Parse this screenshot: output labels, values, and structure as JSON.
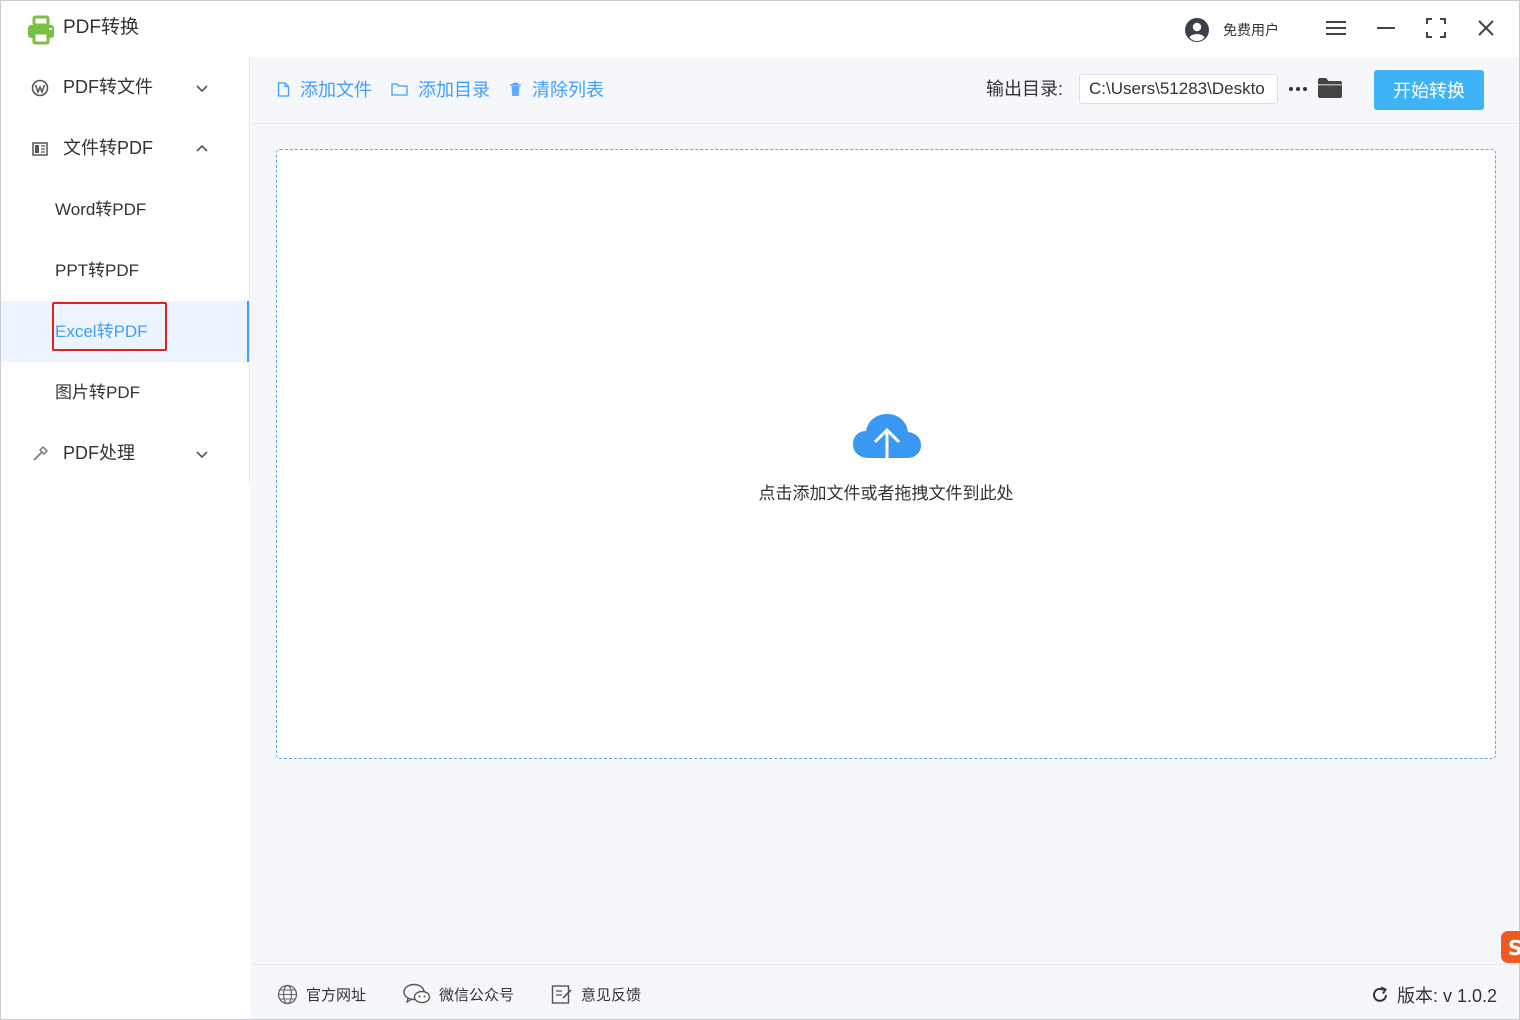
{
  "app": {
    "title": "PDF转换",
    "brand_color": "#7ac143"
  },
  "user": {
    "name": "免费用户"
  },
  "window_controls": [
    "menu-icon",
    "minimize-icon",
    "maximize-icon",
    "close-icon"
  ],
  "sidebar": {
    "groups": [
      {
        "label": "PDF转文件",
        "icon": "wordpress-icon",
        "expanded": false
      },
      {
        "label": "文件转PDF",
        "icon": "document-icon",
        "expanded": true,
        "items": [
          {
            "label": "Word转PDF",
            "active": false
          },
          {
            "label": "PPT转PDF",
            "active": false
          },
          {
            "label": "Excel转PDF",
            "active": true
          },
          {
            "label": "图片转PDF",
            "active": false
          }
        ]
      },
      {
        "label": "PDF处理",
        "icon": "hammer-icon",
        "expanded": false
      }
    ],
    "active_color": "#409eff"
  },
  "toolbar": {
    "add_file": "添加文件",
    "add_dir": "添加目录",
    "clear_list": "清除列表",
    "output_label": "输出目录:",
    "output_path": "C:\\Users\\51283\\Deskto",
    "start_button": "开始转换",
    "accent_color": "#3fb3f7"
  },
  "dropzone": {
    "text": "点击添加文件或者拖拽文件到此处"
  },
  "footer": {
    "official_site": "官方网址",
    "wechat": "微信公众号",
    "feedback": "意见反馈",
    "version": "版本: v 1.0.2"
  }
}
